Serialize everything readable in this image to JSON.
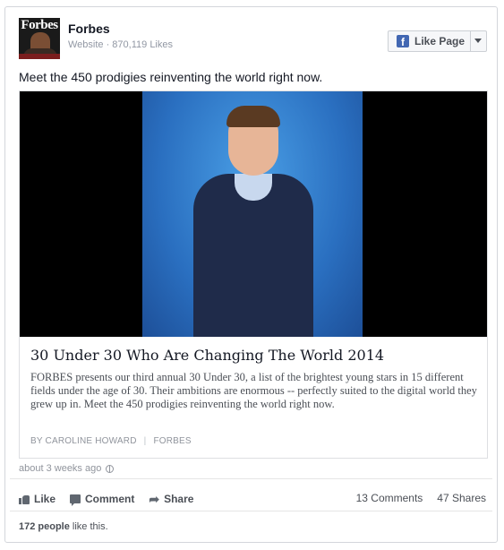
{
  "post": {
    "page_name": "Forbes",
    "page_meta": "Website · 870,119 Likes",
    "avatar_logo_text": "Forbes",
    "like_page_label": "Like Page",
    "message": "Meet the 450 prodigies reinventing the world right now.",
    "timestamp": "about 3 weeks ago"
  },
  "attachment": {
    "title": "30 Under 30 Who Are Changing The World 2014",
    "description": "FORBES presents our third annual 30 Under 30, a list of the brightest young stars in 15 different fields under the age of 30. Their ambitions are enormous -- perfectly suited to the digital world they grew up in. Meet the 450 prodigies reinventing the world right now.",
    "author": "By Caroline Howard",
    "separator": "|",
    "source": "Forbes"
  },
  "actions": {
    "like_label": "Like",
    "comment_label": "Comment",
    "share_label": "Share",
    "comments_count": "13 Comments",
    "shares_count": "47 Shares"
  },
  "likes_summary": {
    "count_text": "172 people",
    "suffix": " like this."
  },
  "icons": {
    "like": "thumbs-up-icon",
    "comment": "speech-bubble-icon",
    "share": "share-arrow-icon",
    "audience": "globe-icon",
    "facebook": "facebook-f-icon",
    "dropdown": "caret-down-icon"
  },
  "colors": {
    "facebook_blue": "#4267b2",
    "text_primary": "#141823",
    "text_secondary": "#4b4f56",
    "text_muted": "#90949c",
    "border": "#d3d6db"
  }
}
